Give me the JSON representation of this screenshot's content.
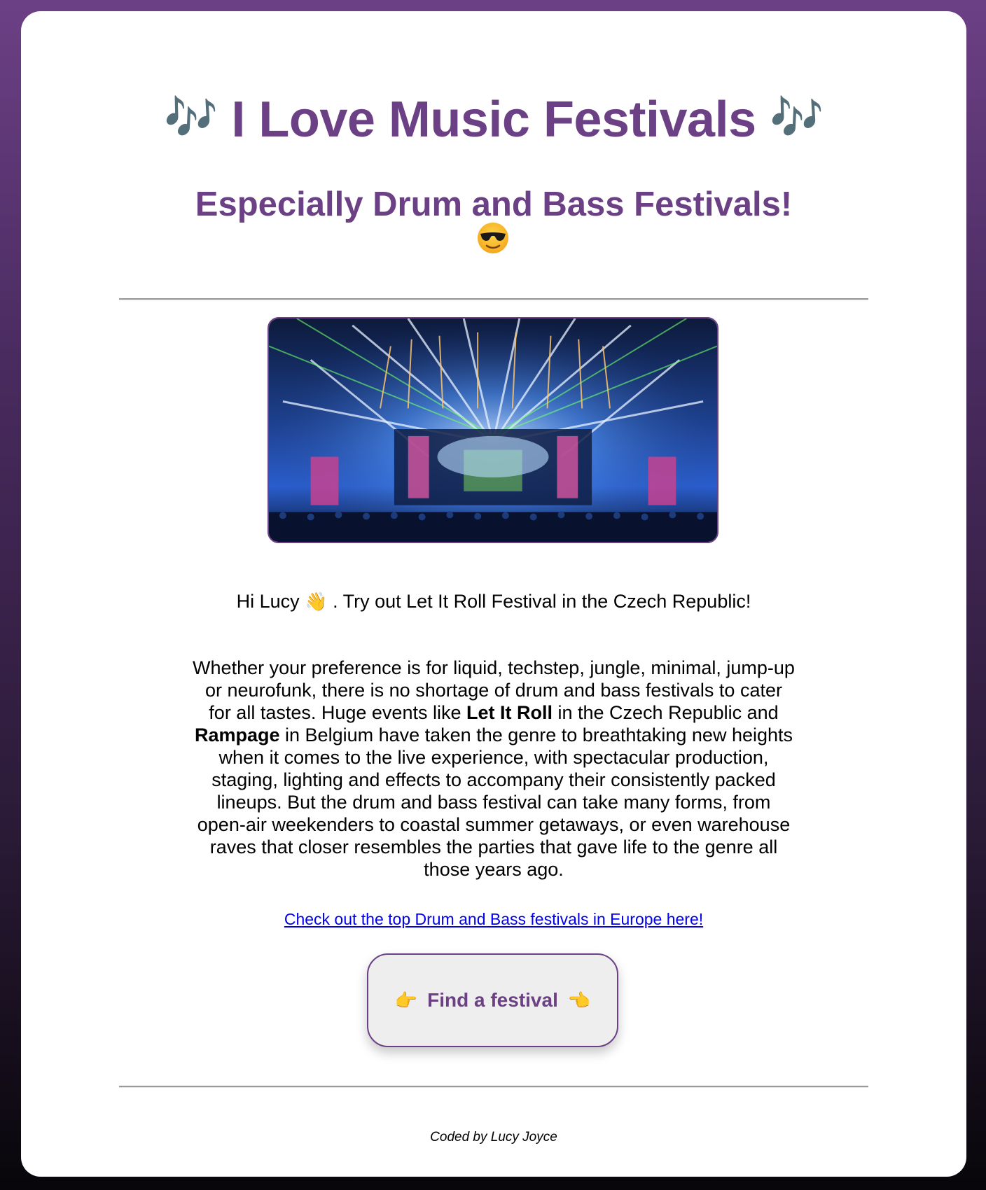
{
  "header": {
    "title": "I Love Music Festivals",
    "title_icon_left": "🎶",
    "title_icon_right": "🎶",
    "subtitle_prefix": "Especially ",
    "subtitle_bold": "Drum and Bass",
    "subtitle_suffix": " Festivals!",
    "subtitle_emoji": "sunglasses-face-icon"
  },
  "hero_image": {
    "description": "festival-stage-lights-image"
  },
  "greeting": {
    "prefix": "Hi Lucy ",
    "icon": "👋",
    "suffix": " . Try out Let It Roll Festival in the Czech Republic!"
  },
  "body": {
    "part1": "Whether your preference is for liquid, techstep, jungle, minimal, jump-up or neurofunk, there is no shortage of drum and bass festivals to cater for all tastes. Huge events like ",
    "bold1": "Let It Roll",
    "part2": " in the Czech Republic and ",
    "bold2": "Rampage",
    "part3": " in Belgium have taken the genre to breathtaking new heights when it comes to the live experience, with spectacular production, staging, lighting and effects to accompany their consistently packed lineups. But the drum and bass festival can take many forms, from open-air weekenders to coastal summer getaways, or even warehouse raves that closer resembles the parties that gave life to the genre all those years ago."
  },
  "link": {
    "label": "Check out the top Drum and Bass festivals in Europe here!"
  },
  "cta": {
    "label": "Find a festival",
    "icon_left": "👉",
    "icon_right": "👈"
  },
  "footer": {
    "credit": "Coded by Lucy Joyce"
  },
  "colors": {
    "brand_purple": "#6c4085",
    "link_blue": "#0000ee",
    "button_bg": "#efeeef"
  }
}
